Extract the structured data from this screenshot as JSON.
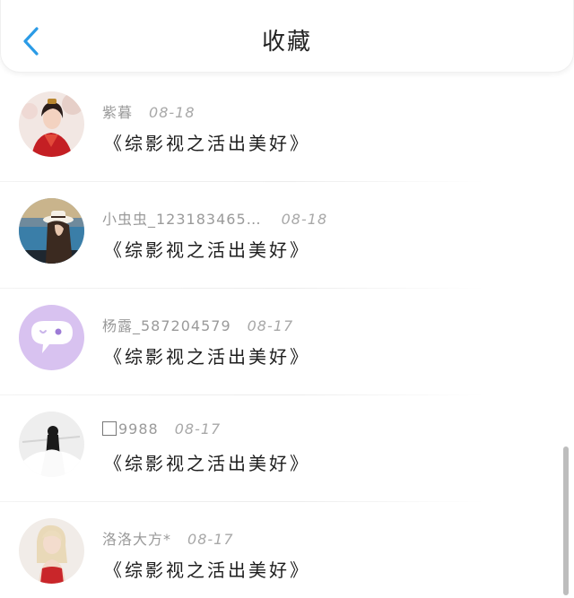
{
  "header": {
    "title": "收藏",
    "back_icon": "chevron-left-icon",
    "accent_color": "#2b9be6"
  },
  "items": [
    {
      "name": "紫暮",
      "date": "08-18",
      "book": "《综影视之活出美好》",
      "avatar": "avatar-red-costume"
    },
    {
      "name": "小虫虫_123183465…",
      "date": "08-18",
      "book": "《综影视之活出美好》",
      "avatar": "avatar-hat-lake"
    },
    {
      "name": "杨露_587204579",
      "date": "08-17",
      "book": "《综影视之活出美好》",
      "avatar": "avatar-default-chat"
    },
    {
      "name": "9988",
      "date": "08-17",
      "book": "《综影视之活出美好》",
      "avatar": "avatar-white-dress"
    },
    {
      "name": "洛洛大方*",
      "date": "08-17",
      "book": "《综影视之活出美好》",
      "avatar": "avatar-blonde-red"
    }
  ]
}
